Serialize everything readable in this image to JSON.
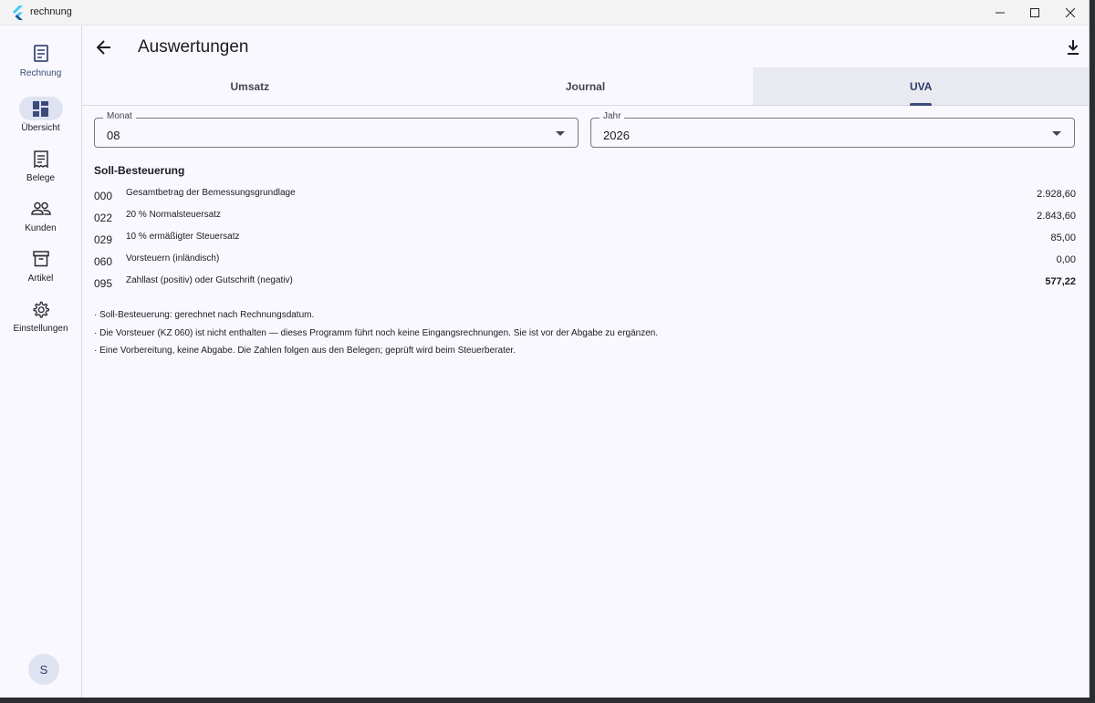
{
  "window": {
    "title": "rechnung",
    "colors": {
      "brand": "#3b4a7a",
      "background": "#f8f8fe",
      "tab_active_bg": "#e8e9f1"
    }
  },
  "rail": {
    "brand_label": "Rechnung",
    "items": [
      {
        "label": "Übersicht",
        "icon": "dashboard-icon",
        "active": true
      },
      {
        "label": "Belege",
        "icon": "receipt-icon"
      },
      {
        "label": "Kunden",
        "icon": "people-icon"
      },
      {
        "label": "Artikel",
        "icon": "archive-icon"
      },
      {
        "label": "Einstellungen",
        "icon": "gear-icon"
      }
    ],
    "avatar": "S"
  },
  "header": {
    "title": "Auswertungen"
  },
  "tabs": [
    {
      "label": "Umsatz"
    },
    {
      "label": "Journal"
    },
    {
      "label": "UVA",
      "active": true
    }
  ],
  "filters": {
    "month": {
      "label": "Monat",
      "value": "08"
    },
    "year": {
      "label": "Jahr",
      "value": "2026"
    }
  },
  "section": {
    "title": "Soll-Besteuerung",
    "rows": [
      {
        "code": "000",
        "desc": "Gesamtbetrag der Bemessungsgrundlage",
        "amount": "2.928,60"
      },
      {
        "code": "022",
        "desc": "20 % Normalsteuersatz",
        "amount": "2.843,60"
      },
      {
        "code": "029",
        "desc": "10 % ermäßigter Steuersatz",
        "amount": "85,00"
      },
      {
        "code": "060",
        "desc": "Vorsteuern (inländisch)",
        "amount": "0,00"
      },
      {
        "code": "095",
        "desc": "Zahllast (positiv) oder Gutschrift (negativ)",
        "amount": "577,22"
      }
    ]
  },
  "notes": [
    "· Soll-Besteuerung: gerechnet nach Rechnungsdatum.",
    "· Die Vorsteuer (KZ 060) ist nicht enthalten — dieses Programm führt noch keine Eingangsrechnungen. Sie ist vor der Abgabe zu ergänzen.",
    "· Eine Vorbereitung, keine Abgabe. Die Zahlen folgen aus den Belegen; geprüft wird beim Steuerberater."
  ]
}
